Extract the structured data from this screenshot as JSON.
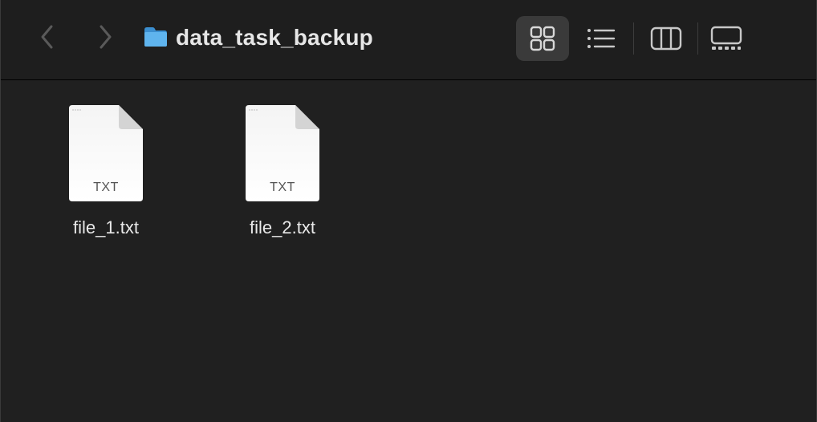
{
  "window": {
    "title": "data_task_backup"
  },
  "toolbar": {
    "back_icon": "chevron-left-icon",
    "forward_icon": "chevron-right-icon",
    "folder_icon": "folder-icon",
    "view_modes": [
      {
        "name": "icons",
        "icon": "grid-icon",
        "selected": true
      },
      {
        "name": "list",
        "icon": "list-icon",
        "selected": false
      },
      {
        "name": "columns",
        "icon": "columns-icon",
        "selected": false
      },
      {
        "name": "gallery",
        "icon": "gallery-icon",
        "selected": false
      }
    ]
  },
  "files": [
    {
      "name": "file_1.txt",
      "ext_label": "TXT"
    },
    {
      "name": "file_2.txt",
      "ext_label": "TXT"
    }
  ],
  "colors": {
    "background": "#202020",
    "toolbar": "#1e1e1e",
    "selected_view_bg": "#3a3a3a",
    "folder_blue": "#4ea7e8",
    "text": "#e8e8e8",
    "disabled_icon": "#5a5a5a"
  }
}
